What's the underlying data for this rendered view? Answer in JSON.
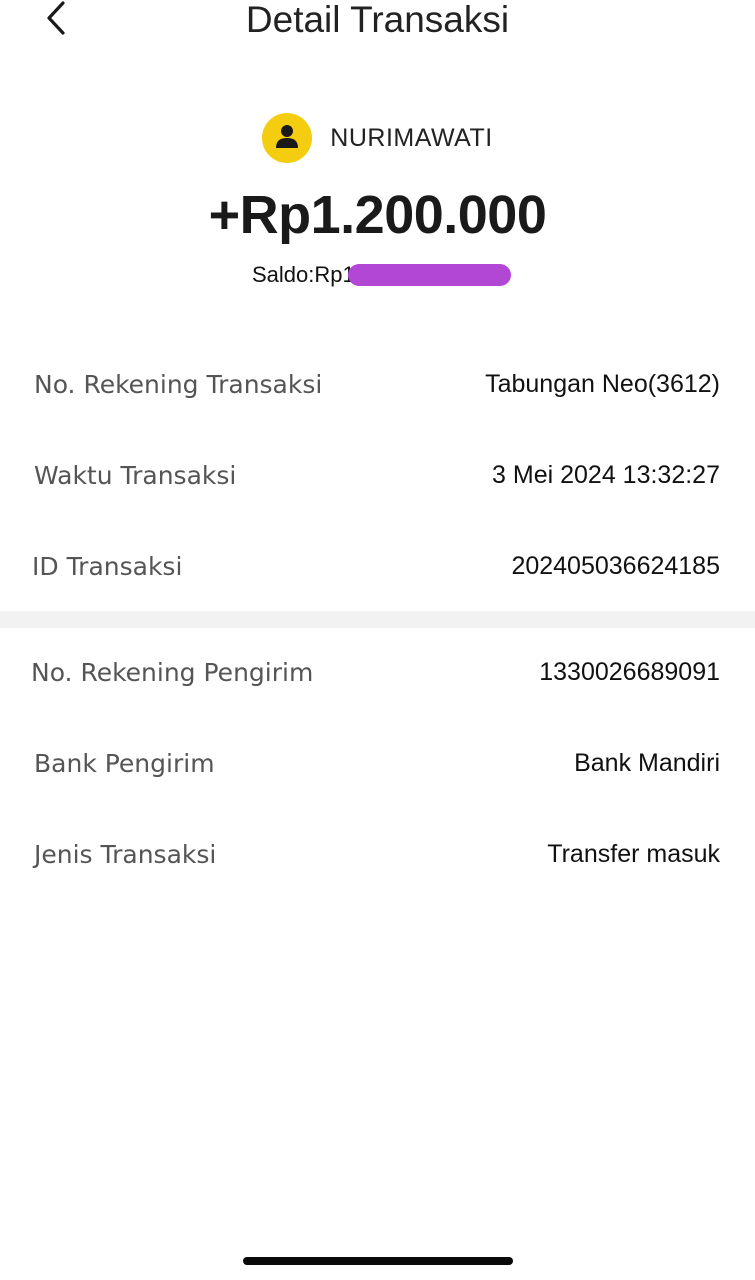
{
  "header": {
    "title": "Detail Transaksi",
    "back_icon": "chevron-left-icon"
  },
  "summary": {
    "sender_name": "NURIMAWATI",
    "avatar_icon": "person-icon",
    "avatar_color": "#f5cd10",
    "amount": "+Rp1.200.000",
    "balance_label": "Saldo:Rp1",
    "redaction_color": "#b247d6"
  },
  "transaction": {
    "rows": [
      {
        "label": "No. Rekening Transaksi",
        "value": "Tabungan Neo(3612)"
      },
      {
        "label": "Waktu Transaksi",
        "value": "3 Mei 2024 13:32:27"
      },
      {
        "label": "ID Transaksi",
        "value": "202405036624185"
      }
    ]
  },
  "sender_details": {
    "rows": [
      {
        "label": "No. Rekening Pengirim",
        "value": "1330026689091"
      },
      {
        "label": "Bank Pengirim",
        "value": "Bank Mandiri"
      },
      {
        "label": "Jenis Transaksi",
        "value": "Transfer masuk"
      }
    ]
  }
}
